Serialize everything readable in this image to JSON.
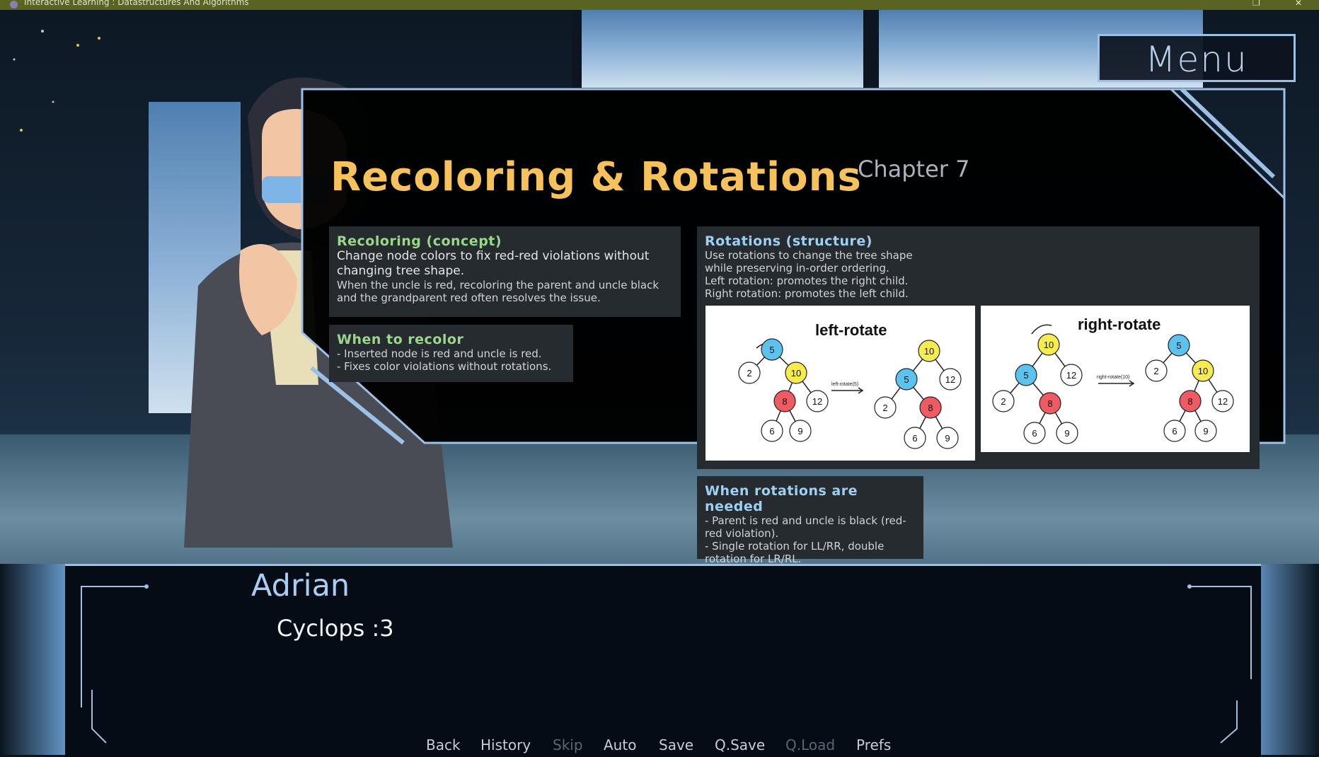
{
  "window": {
    "title": "Interactive Learning : Datastructures And Algorithms",
    "controls": [
      "❐",
      "✕"
    ]
  },
  "menu": {
    "label": "Menu"
  },
  "chapter": {
    "title": "Recoloring & Rotations",
    "number": "Chapter 7"
  },
  "cards": {
    "recoloring": {
      "heading": "Recoloring (concept)",
      "lead": "Change node colors to fix red-red violations without changing tree shape.",
      "detail": "When the uncle is red, recoloring the parent and uncle black and the grandparent red often resolves the issue."
    },
    "when_recolor": {
      "heading": "When to recolor",
      "items": [
        "- Inserted node is red and uncle is red.",
        "- Fixes color violations without rotations."
      ]
    },
    "rotations": {
      "heading": "Rotations (structure)",
      "lines": [
        "Use rotations to change the tree shape",
        "while preserving in-order ordering.",
        "Left rotation: promotes the right child.",
        "Right rotation: promotes the left child."
      ]
    },
    "when_rotate": {
      "heading": "When rotations are needed",
      "items": [
        "- Parent is red and uncle is black (red-red violation).",
        "- Single rotation for LL/RR, double rotation for LR/RL."
      ]
    }
  },
  "diagrams": {
    "left": {
      "title": "left-rotate",
      "arrow_label": "left-rotate(5)"
    },
    "right": {
      "title": "right-rotate",
      "arrow_label": "right-rotate(10)"
    },
    "node_labels": {
      "a": "5",
      "b": "10",
      "c": "2",
      "d": "8",
      "e": "12",
      "f": "6",
      "g": "9"
    },
    "colors": {
      "blue": "#5cc3ef",
      "yellow": "#f6ec4f",
      "red": "#ef5b62",
      "white": "#ffffff"
    }
  },
  "dialogue": {
    "speaker": "Adrian",
    "text": "Cyclops :3"
  },
  "quick_menu": [
    {
      "label": "Back",
      "enabled": true
    },
    {
      "label": "History",
      "enabled": true
    },
    {
      "label": "Skip",
      "enabled": false
    },
    {
      "label": "Auto",
      "enabled": true
    },
    {
      "label": "Save",
      "enabled": true
    },
    {
      "label": "Q.Save",
      "enabled": true
    },
    {
      "label": "Q.Load",
      "enabled": false
    },
    {
      "label": "Prefs",
      "enabled": true
    }
  ],
  "colors": {
    "accent_frame": "#9cc0e6",
    "title_gold": "#f7c25a",
    "heading_green": "#9ad78b",
    "heading_blue": "#9dd0f2"
  }
}
